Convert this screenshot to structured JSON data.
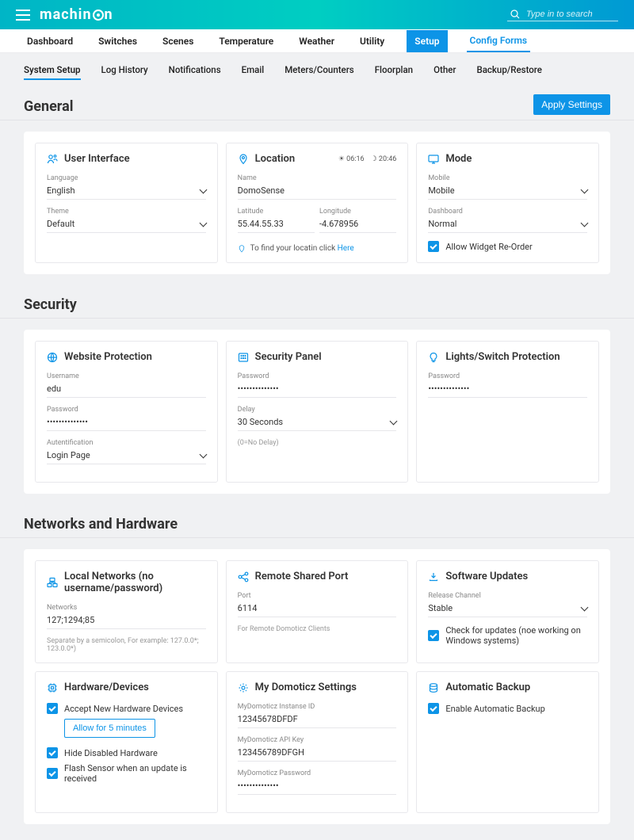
{
  "header": {
    "logo": "machinOn",
    "search_placeholder": "Type in to search"
  },
  "tabs": {
    "main": [
      "Dashboard",
      "Switches",
      "Scenes",
      "Temperature",
      "Weather",
      "Utility",
      "Setup",
      "Config Forms"
    ],
    "active_main": "Setup",
    "underlined_main": "Config Forms",
    "sub": [
      "System Setup",
      "Log History",
      "Notifications",
      "Email",
      "Meters/Counters",
      "Floorplan",
      "Other",
      "Backup/Restore"
    ],
    "active_sub": "System Setup"
  },
  "apply_label": "Apply Settings",
  "sections": {
    "general": {
      "title": "General",
      "ui": {
        "title": "User Interface",
        "language_label": "Language",
        "language": "English",
        "theme_label": "Theme",
        "theme": "Default"
      },
      "location": {
        "title": "Location",
        "sunrise": "06:16",
        "sunset": "20:46",
        "name_label": "Name",
        "name": "DomoSense",
        "lat_label": "Latitude",
        "lat": "55.44.55.33",
        "lon_label": "Longitude",
        "lon": "-4.678956",
        "hint_prefix": "To find your locatin click ",
        "hint_link": "Here"
      },
      "mode": {
        "title": "Mode",
        "mobile_label": "Mobile",
        "mobile": "Mobile",
        "dashboard_label": "Dashboard",
        "dashboard": "Normal",
        "reorder": "Allow Widget Re-Order"
      }
    },
    "security": {
      "title": "Security",
      "web": {
        "title": "Website Protection",
        "user_label": "Username",
        "user": "edu",
        "pass_label": "Password",
        "pass": "••••••••••••••",
        "auth_label": "Autentification",
        "auth": "Login Page"
      },
      "panel": {
        "title": "Security Panel",
        "pass_label": "Password",
        "pass": "••••••••••••••",
        "delay_label": "Delay",
        "delay": "30 Seconds",
        "delay_hint": "(0=No Delay)"
      },
      "lights": {
        "title": "Lights/Switch Protection",
        "pass_label": "Password",
        "pass": "••••••••••••••"
      }
    },
    "net": {
      "title": "Networks and Hardware",
      "local": {
        "title": "Local Networks (no username/password)",
        "net_label": "Networks",
        "net": "127;1294;85",
        "hint": "Separate by a semicolon, For example: 127.0.0*; 123.0.0*)"
      },
      "remote": {
        "title": "Remote Shared Port",
        "port_label": "Port",
        "port": "6114",
        "hint": "For Remote Domoticz Clients"
      },
      "updates": {
        "title": "Software Updates",
        "channel_label": "Release Channel",
        "channel": "Stable",
        "check": "Check for updates (noe working on Windows systems)"
      },
      "hw": {
        "title": "Hardware/Devices",
        "accept": "Accept New Hardware Devices",
        "allow_btn": "Allow for 5 minutes",
        "hide": "Hide Disabled Hardware",
        "flash": "Flash Sensor when an update is received"
      },
      "dom": {
        "title": "My Domoticz Settings",
        "id_label": "MyDomoticz Instanse ID",
        "id": "12345678DFDF",
        "key_label": "MyDomoticz API Key",
        "key": "123456789DFGH",
        "pass_label": "MyDomoticz Password",
        "pass": "••••••••••••••"
      },
      "backup": {
        "title": "Automatic Backup",
        "enable": "Enable Automatic Backup"
      }
    }
  }
}
